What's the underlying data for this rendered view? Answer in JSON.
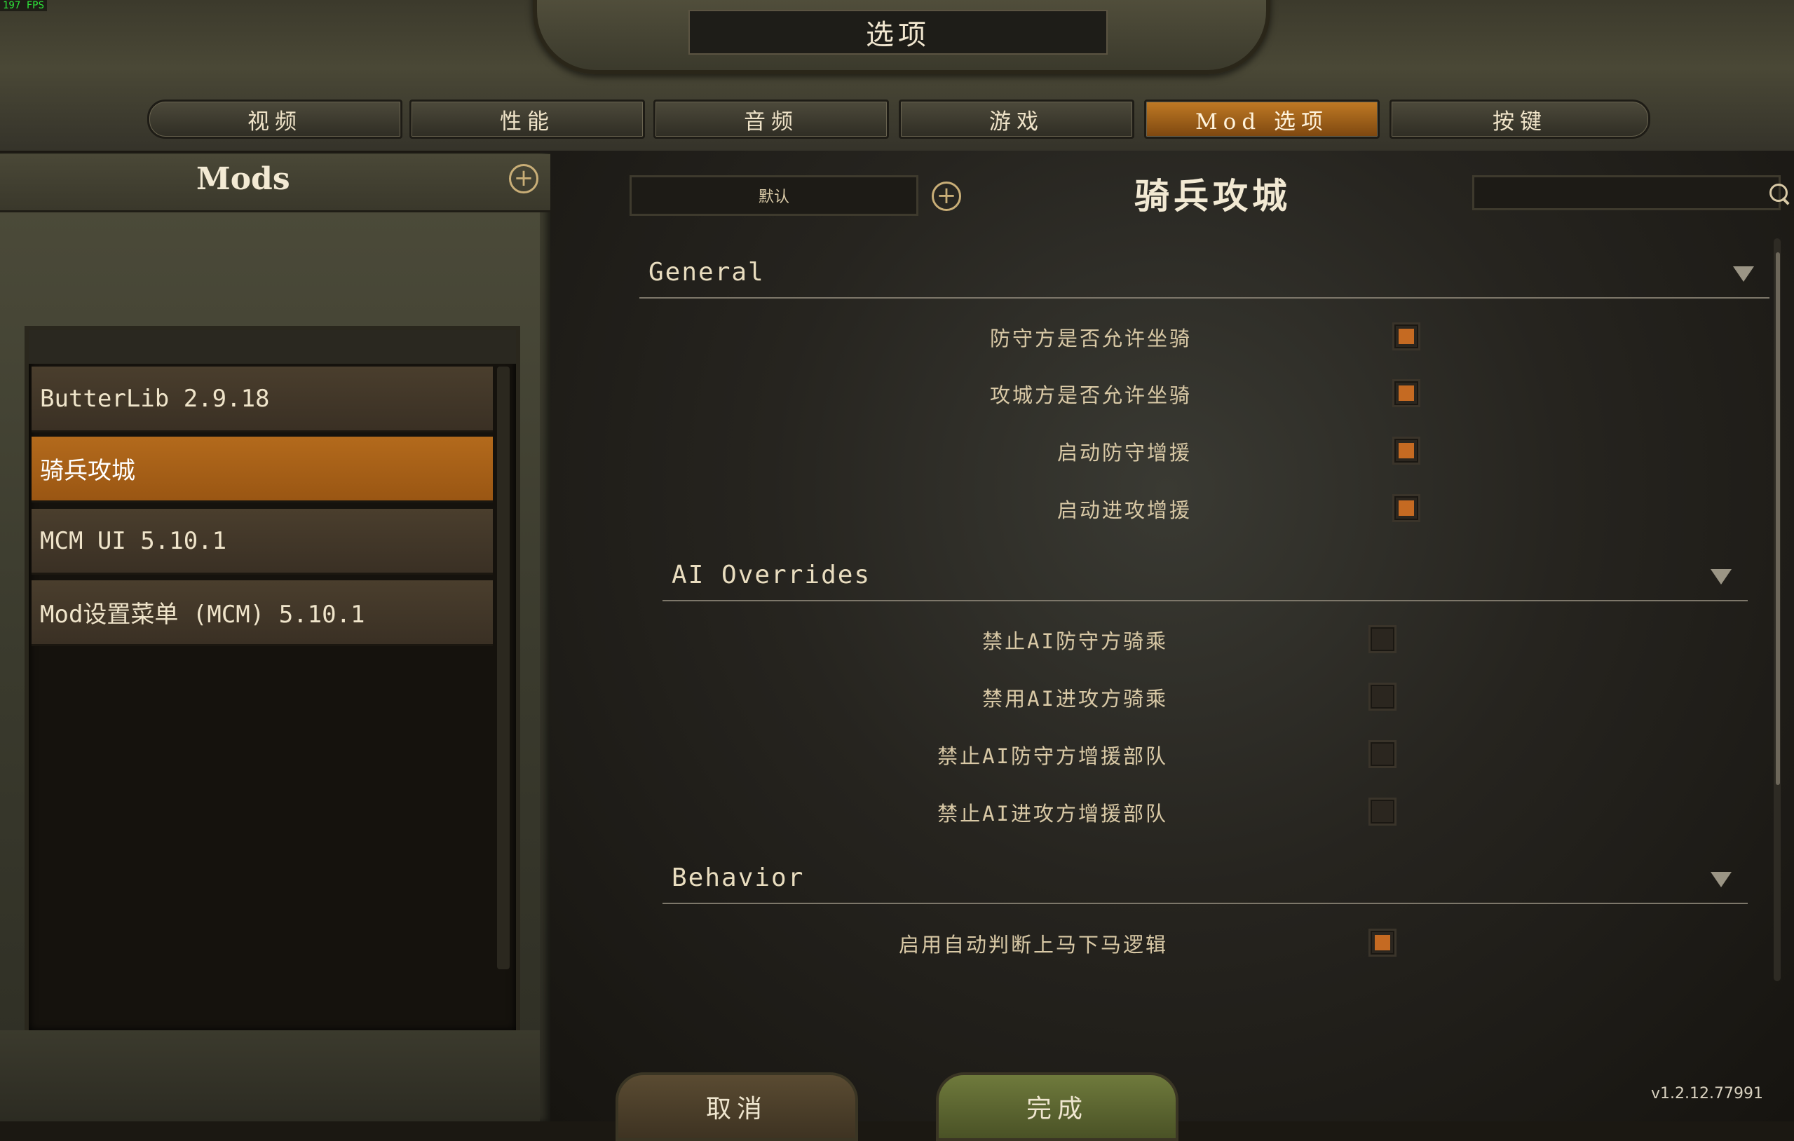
{
  "fps": "197 FPS",
  "window_title": "选项",
  "tabs": [
    {
      "label": "视频"
    },
    {
      "label": "性能"
    },
    {
      "label": "音频"
    },
    {
      "label": "游戏"
    },
    {
      "label": "Mod 选项"
    },
    {
      "label": "按键"
    }
  ],
  "active_tab": "Mod 选项",
  "left_panel": {
    "title": "Mods",
    "mods": [
      {
        "label": "ButterLib 2.9.18"
      },
      {
        "label": "骑兵攻城"
      },
      {
        "label": "MCM UI 5.10.1"
      },
      {
        "label": "Mod设置菜单 (MCM) 5.10.1"
      }
    ],
    "selected_mod": "骑兵攻城"
  },
  "settings": {
    "preset_label": "默认",
    "mod_title": "骑兵攻城",
    "search_value": "",
    "groups": [
      {
        "title": "General",
        "options": [
          {
            "label": "防守方是否允许坐骑",
            "checked": true
          },
          {
            "label": "攻城方是否允许坐骑",
            "checked": true
          },
          {
            "label": "启动防守增援",
            "checked": true
          },
          {
            "label": "启动进攻增援",
            "checked": true
          }
        ]
      },
      {
        "title": "AI Overrides",
        "options": [
          {
            "label": "禁止AI防守方骑乘",
            "checked": false
          },
          {
            "label": "禁用AI进攻方骑乘",
            "checked": false
          },
          {
            "label": "禁止AI防守方增援部队",
            "checked": false
          },
          {
            "label": "禁止AI进攻方增援部队",
            "checked": false
          }
        ]
      },
      {
        "title": "Behavior",
        "options": [
          {
            "label": "启用自动判断上马下马逻辑",
            "checked": true
          }
        ]
      }
    ]
  },
  "buttons": {
    "cancel": "取消",
    "done": "完成"
  },
  "version": "v1.2.12.77991",
  "colors": {
    "accent": "#c56a22",
    "active_tab": "#b36a1c",
    "done_button": "#6f7a3c",
    "text": "#d9c9a6"
  }
}
